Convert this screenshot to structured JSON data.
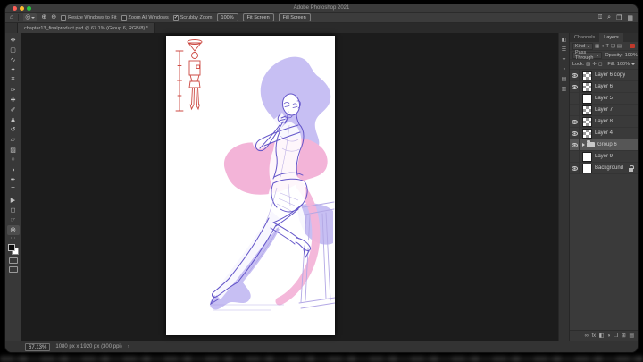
{
  "colors": {
    "traffic_red": "#ff5f57",
    "traffic_yellow": "#febc2e",
    "traffic_green": "#28c840",
    "art_line": "#6355c9",
    "art_faint": "#a89bdf",
    "art_pink": "#f3b4d8",
    "art_lavender": "#c7bff3",
    "art_red": "#cc4a43",
    "art_stool": "#b3a8e5"
  },
  "window": {
    "title": "Adobe Photoshop 2021"
  },
  "options_bar": {
    "home_glyph": "⌂",
    "zoom_tool_glyph": "◎",
    "zoom_in_glyph": "⊕",
    "zoom_out_glyph": "⊖",
    "tool_checkboxes": [
      {
        "label": "Resize Windows to Fit",
        "checked": false
      },
      {
        "label": "Zoom All Windows",
        "checked": false
      },
      {
        "label": "Scrubby Zoom",
        "checked": true
      }
    ],
    "zoom_button": "100%",
    "fit_screen_button": "Fit Screen",
    "fill_screen_button": "Fill Screen",
    "right_icons": [
      {
        "name": "share-icon",
        "glyph": "⍐"
      },
      {
        "name": "search-icon",
        "glyph": "⌕"
      },
      {
        "name": "workspace-icon",
        "glyph": "❒"
      },
      {
        "name": "organizer-icon",
        "glyph": "▦"
      }
    ]
  },
  "document_tab": {
    "title": "chapter13_finalproduct.psd @ 67.1% (Group 6, RGB/8) *"
  },
  "toolbar": {
    "tools": [
      {
        "name": "move-tool",
        "glyph": "✥"
      },
      {
        "name": "marquee-tool",
        "glyph": "▢"
      },
      {
        "name": "lasso-tool",
        "glyph": "∿"
      },
      {
        "name": "magic-wand-tool",
        "glyph": "✦"
      },
      {
        "name": "crop-tool",
        "glyph": "⌗"
      },
      {
        "name": "eyedropper-tool",
        "glyph": "✑"
      },
      {
        "name": "healing-brush-tool",
        "glyph": "✚"
      },
      {
        "name": "brush-tool",
        "glyph": "✐"
      },
      {
        "name": "clone-stamp-tool",
        "glyph": "♟"
      },
      {
        "name": "history-brush-tool",
        "glyph": "↺"
      },
      {
        "name": "eraser-tool",
        "glyph": "▱"
      },
      {
        "name": "gradient-tool",
        "glyph": "▨"
      },
      {
        "name": "blur-tool",
        "glyph": "○"
      },
      {
        "name": "dodge-tool",
        "glyph": "◑"
      },
      {
        "name": "pen-tool",
        "glyph": "✒"
      },
      {
        "name": "type-tool",
        "glyph": "T"
      },
      {
        "name": "path-selection-tool",
        "glyph": "▶"
      },
      {
        "name": "shape-tool",
        "glyph": "◻"
      },
      {
        "name": "hand-tool",
        "glyph": "☞"
      },
      {
        "name": "zoom-tool",
        "glyph": "◎"
      }
    ],
    "more_tools_glyph": "⋯"
  },
  "dock_strip": {
    "icons": [
      {
        "name": "color-panel-icon",
        "glyph": "◧"
      },
      {
        "name": "properties-panel-icon",
        "glyph": "☰"
      },
      {
        "name": "adjustments-panel-icon",
        "glyph": "✦"
      },
      {
        "name": "history-panel-icon",
        "glyph": "◔"
      },
      {
        "name": "brushes-panel-icon",
        "glyph": "▤"
      },
      {
        "name": "libraries-panel-icon",
        "glyph": "▥"
      }
    ]
  },
  "layers_panel": {
    "tabs": [
      {
        "label": "Channels",
        "active": false
      },
      {
        "label": "Layers",
        "active": true
      }
    ],
    "filter_label": "Kind",
    "filter_icons": [
      "▦",
      "◑",
      "T",
      "❏",
      "▤"
    ],
    "blend_mode": "Pass Through",
    "opacity_label": "Opacity:",
    "opacity_value": "100%",
    "lock_label": "Lock:",
    "lock_icons": [
      "▨",
      "✛",
      "◻"
    ],
    "fill_label": "Fill:",
    "fill_value": "100%",
    "layers": [
      {
        "name": "Layer 6 copy",
        "visible": true,
        "type": "pixel",
        "selected": false,
        "locked": false
      },
      {
        "name": "Layer 6",
        "visible": true,
        "type": "pixel",
        "selected": false,
        "locked": false
      },
      {
        "name": "Layer 5",
        "visible": false,
        "type": "pixel",
        "selected": false,
        "locked": false
      },
      {
        "name": "Layer 7",
        "visible": false,
        "type": "pixel",
        "selected": false,
        "locked": false
      },
      {
        "name": "Layer 8",
        "visible": true,
        "type": "pixel",
        "selected": false,
        "locked": false
      },
      {
        "name": "Layer 4",
        "visible": true,
        "type": "pixel",
        "selected": false,
        "locked": false
      },
      {
        "name": "Group 6",
        "visible": true,
        "type": "group",
        "selected": true,
        "locked": false
      },
      {
        "name": "Layer 9",
        "visible": false,
        "type": "pixel",
        "selected": false,
        "locked": false
      },
      {
        "name": "Background",
        "visible": true,
        "type": "background",
        "selected": false,
        "locked": true
      }
    ],
    "bottom_icons": [
      {
        "name": "link-layers-icon",
        "glyph": "∞"
      },
      {
        "name": "layer-style-icon",
        "glyph": "fx"
      },
      {
        "name": "layer-mask-icon",
        "glyph": "◧"
      },
      {
        "name": "adjustment-layer-icon",
        "glyph": "◑"
      },
      {
        "name": "new-group-icon",
        "glyph": "❒"
      },
      {
        "name": "new-layer-icon",
        "glyph": "⊞"
      },
      {
        "name": "delete-layer-icon",
        "glyph": "▤"
      }
    ]
  },
  "status_bar": {
    "zoom": "67.13%",
    "info": "1080 px x 1920 px (300 ppi)",
    "chevron": "›"
  }
}
